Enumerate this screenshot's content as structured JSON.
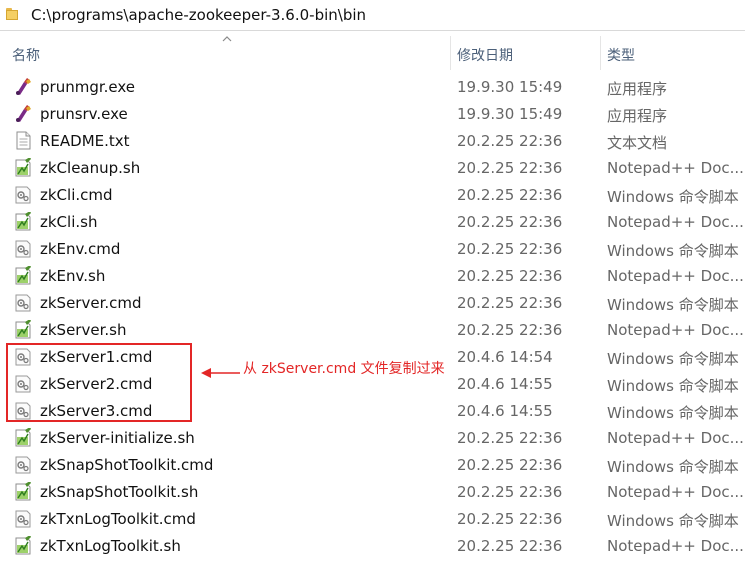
{
  "window": {
    "path": "C:\\programs\\apache-zookeeper-3.6.0-bin\\bin"
  },
  "columns": {
    "name": "名称",
    "date": "修改日期",
    "type": "类型"
  },
  "files": [
    {
      "name": "prunmgr.exe",
      "date": "19.9.30 15:49",
      "type": "应用程序",
      "icon": "exe-icon"
    },
    {
      "name": "prunsrv.exe",
      "date": "19.9.30 15:49",
      "type": "应用程序",
      "icon": "exe-icon"
    },
    {
      "name": "README.txt",
      "date": "20.2.25 22:36",
      "type": "文本文档",
      "icon": "text-file-icon"
    },
    {
      "name": "zkCleanup.sh",
      "date": "20.2.25 22:36",
      "type": "Notepad++ Doc...",
      "icon": "notepad-file-icon"
    },
    {
      "name": "zkCli.cmd",
      "date": "20.2.25 22:36",
      "type": "Windows 命令脚本",
      "icon": "cmd-file-icon"
    },
    {
      "name": "zkCli.sh",
      "date": "20.2.25 22:36",
      "type": "Notepad++ Doc...",
      "icon": "notepad-file-icon"
    },
    {
      "name": "zkEnv.cmd",
      "date": "20.2.25 22:36",
      "type": "Windows 命令脚本",
      "icon": "cmd-file-icon"
    },
    {
      "name": "zkEnv.sh",
      "date": "20.2.25 22:36",
      "type": "Notepad++ Doc...",
      "icon": "notepad-file-icon"
    },
    {
      "name": "zkServer.cmd",
      "date": "20.2.25 22:36",
      "type": "Windows 命令脚本",
      "icon": "cmd-file-icon"
    },
    {
      "name": "zkServer.sh",
      "date": "20.2.25 22:36",
      "type": "Notepad++ Doc...",
      "icon": "notepad-file-icon"
    },
    {
      "name": "zkServer1.cmd",
      "date": "20.4.6 14:54",
      "type": "Windows 命令脚本",
      "icon": "cmd-file-icon"
    },
    {
      "name": "zkServer2.cmd",
      "date": "20.4.6 14:55",
      "type": "Windows 命令脚本",
      "icon": "cmd-file-icon"
    },
    {
      "name": "zkServer3.cmd",
      "date": "20.4.6 14:55",
      "type": "Windows 命令脚本",
      "icon": "cmd-file-icon"
    },
    {
      "name": "zkServer-initialize.sh",
      "date": "20.2.25 22:36",
      "type": "Notepad++ Doc...",
      "icon": "notepad-file-icon"
    },
    {
      "name": "zkSnapShotToolkit.cmd",
      "date": "20.2.25 22:36",
      "type": "Windows 命令脚本",
      "icon": "cmd-file-icon"
    },
    {
      "name": "zkSnapShotToolkit.sh",
      "date": "20.2.25 22:36",
      "type": "Notepad++ Doc...",
      "icon": "notepad-file-icon"
    },
    {
      "name": "zkTxnLogToolkit.cmd",
      "date": "20.2.25 22:36",
      "type": "Windows 命令脚本",
      "icon": "cmd-file-icon"
    },
    {
      "name": "zkTxnLogToolkit.sh",
      "date": "20.2.25 22:36",
      "type": "Notepad++ Doc...",
      "icon": "notepad-file-icon"
    }
  ],
  "annotation": {
    "text": "从 zkServer.cmd 文件复制过来",
    "color": "#e32626"
  }
}
